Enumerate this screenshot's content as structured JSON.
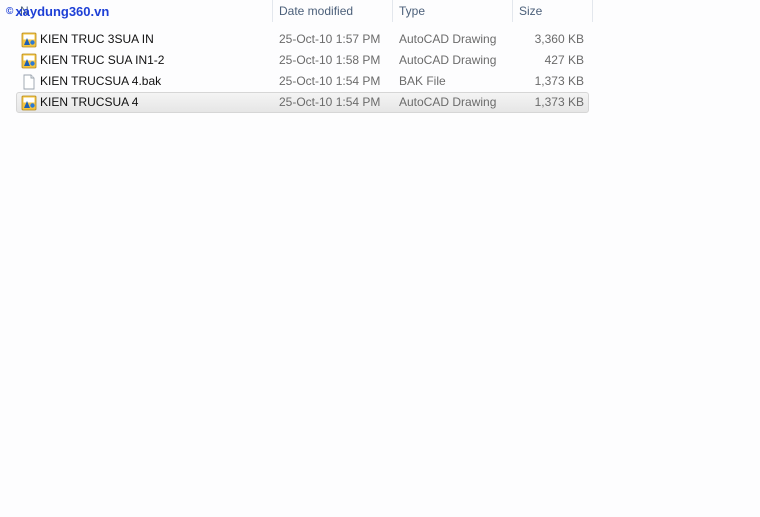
{
  "header": {
    "name_label": "N",
    "date_label": "Date modified",
    "type_label": "Type",
    "size_label": "Size"
  },
  "watermark": {
    "symbol": "©",
    "text": "xaydung360.vn"
  },
  "files": [
    {
      "name": "KIEN TRUC 3SUA IN",
      "date": "25-Oct-10 1:57 PM",
      "type": "AutoCAD Drawing",
      "size": "3,360 KB",
      "icon": "autocad-icon",
      "selected": false
    },
    {
      "name": "KIEN TRUC SUA IN1-2",
      "date": "25-Oct-10 1:58 PM",
      "type": "AutoCAD Drawing",
      "size": "427 KB",
      "icon": "autocad-icon",
      "selected": false
    },
    {
      "name": "KIEN TRUCSUA 4.bak",
      "date": "25-Oct-10 1:54 PM",
      "type": "BAK File",
      "size": "1,373 KB",
      "icon": "blank-file-icon",
      "selected": false
    },
    {
      "name": "KIEN TRUCSUA 4",
      "date": "25-Oct-10 1:54 PM",
      "type": "AutoCAD Drawing",
      "size": "1,373 KB",
      "icon": "autocad-icon",
      "selected": true
    }
  ],
  "colors": {
    "selection": "#e8e8e8",
    "header_text": "#4c607a",
    "watermark": "#1d3fd6"
  }
}
